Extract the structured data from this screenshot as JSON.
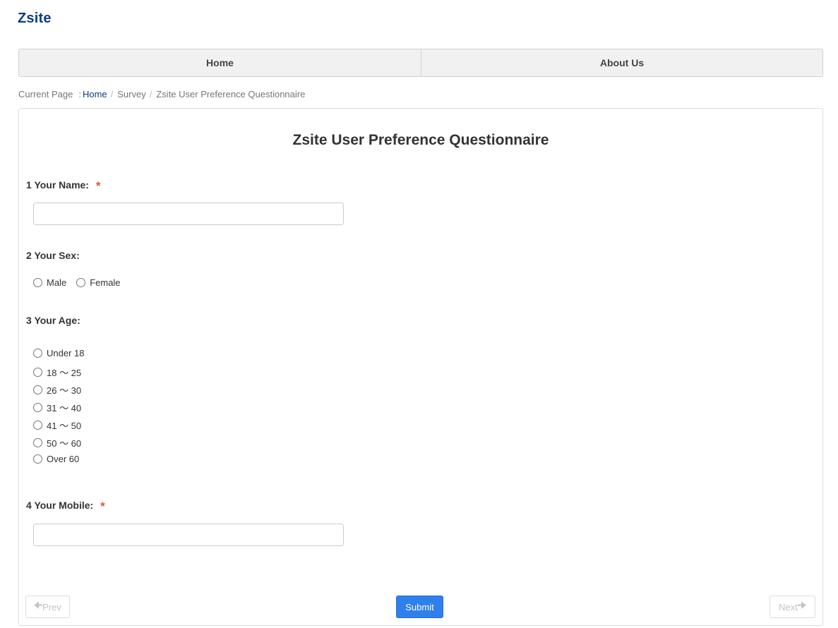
{
  "site": {
    "title": "Zsite"
  },
  "nav": {
    "items": [
      {
        "label": "Home"
      },
      {
        "label": "About Us"
      }
    ]
  },
  "breadcrumb": {
    "prefix": "Current Page",
    "colon": ":",
    "items": [
      "Home",
      "Survey",
      "Zsite User Preference Questionnaire"
    ],
    "separator": "/"
  },
  "survey": {
    "title": "Zsite User Preference Questionnaire",
    "questions": [
      {
        "number": "1",
        "label": "Your Name:",
        "required": true,
        "type": "text",
        "value": "",
        "placeholder": ""
      },
      {
        "number": "2",
        "label": "Your Sex:",
        "required": false,
        "type": "radio",
        "options": [
          "Male",
          "Female"
        ]
      },
      {
        "number": "3",
        "label": "Your Age:",
        "required": false,
        "type": "radio",
        "options": [
          "Under 18",
          "18 ～ 25",
          "26 ～ 30",
          "31 ～ 40",
          "41 ～ 50",
          "50 ～ 60",
          "Over 60"
        ]
      },
      {
        "number": "4",
        "label": "Your Mobile:",
        "required": true,
        "type": "text",
        "value": "",
        "placeholder": ""
      }
    ],
    "required_marker": "*"
  },
  "buttons": {
    "prev_label": "Prev",
    "prev_icon": "arrow-left-icon",
    "submit_label": "Submit",
    "next_label": "Next",
    "next_icon": "arrow-right-icon"
  },
  "colors": {
    "brand": "#0d3d82",
    "required": "#e0533a",
    "submit": "#2f80ec"
  }
}
